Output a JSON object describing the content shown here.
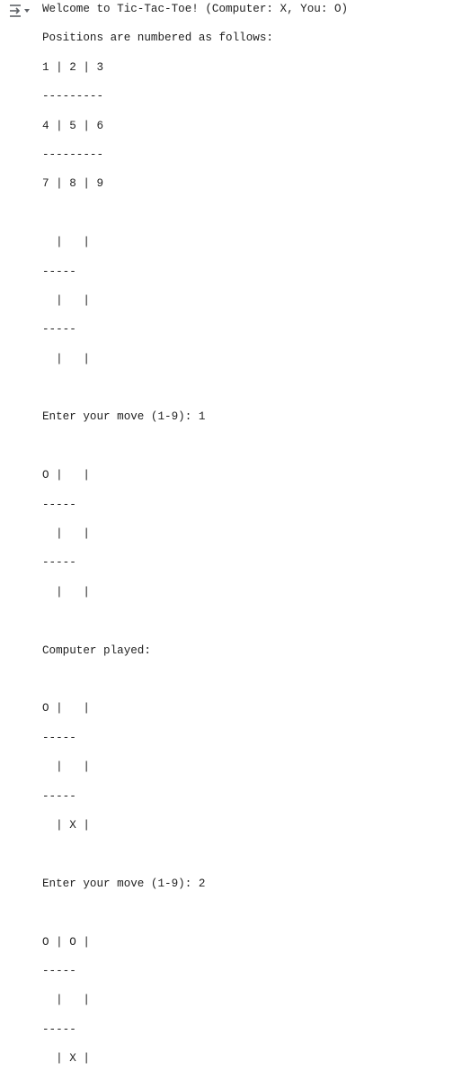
{
  "output_toggle": {
    "icon": "output-collapse-icon"
  },
  "console": {
    "lines": [
      "Welcome to Tic-Tac-Toe! (Computer: X, You: O)",
      "Positions are numbered as follows:",
      "1 | 2 | 3",
      "---------",
      "4 | 5 | 6",
      "---------",
      "7 | 8 | 9",
      "",
      "  |   |",
      "-----",
      "  |   |",
      "-----",
      "  |   |",
      "",
      "Enter your move (1-9): 1",
      "",
      "O |   |",
      "-----",
      "  |   |",
      "-----",
      "  |   |",
      "",
      "Computer played:",
      "",
      "O |   |",
      "-----",
      "  |   |",
      "-----",
      "  | X |",
      "",
      "Enter your move (1-9): 2",
      "",
      "O | O |",
      "-----",
      "  |   |",
      "-----",
      "  | X |"
    ]
  }
}
